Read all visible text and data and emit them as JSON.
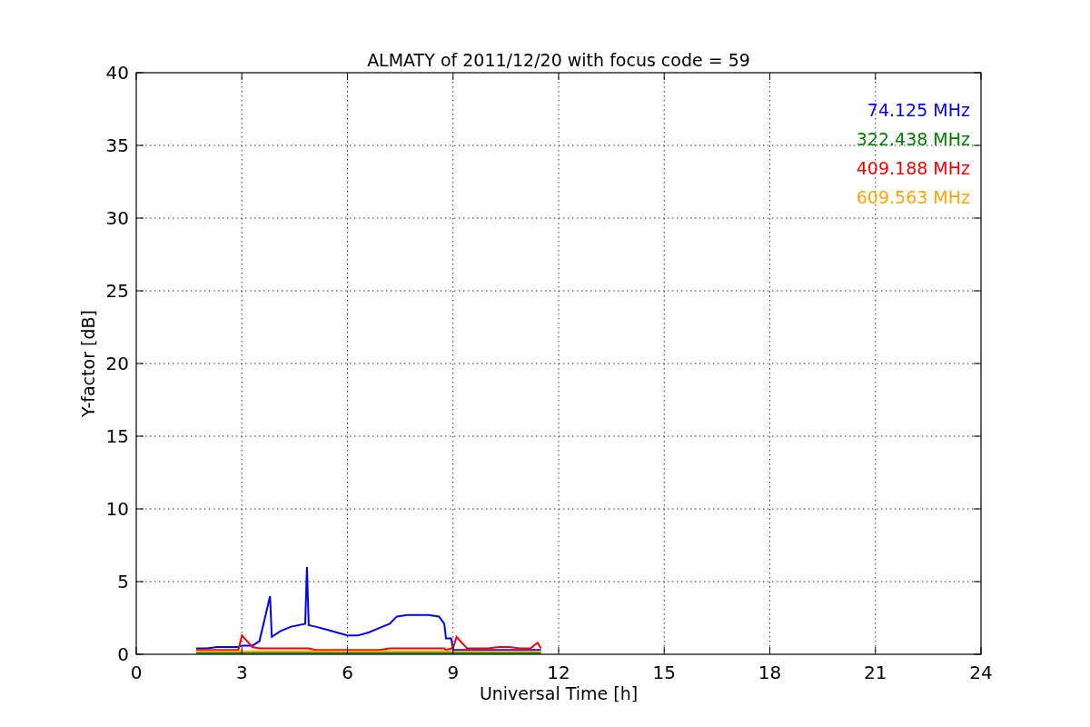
{
  "chart_data": {
    "type": "line",
    "title": "ALMATY of 2011/12/20 with focus code = 59",
    "xlabel": "Universal Time [h]",
    "ylabel": "Y-factor [dB]",
    "x": [
      1.7,
      2.0,
      2.3,
      2.6,
      2.9,
      3.0,
      3.3,
      3.5,
      3.8,
      3.85,
      4.1,
      4.4,
      4.8,
      4.85,
      4.9,
      5.1,
      5.4,
      5.7,
      6.0,
      6.3,
      6.6,
      6.9,
      7.2,
      7.4,
      7.7,
      8.0,
      8.3,
      8.6,
      8.75,
      8.8,
      8.95,
      9.0,
      9.1,
      9.4,
      9.7,
      10.0,
      10.3,
      10.6,
      10.9,
      11.2,
      11.4,
      11.5
    ],
    "series": [
      {
        "name": "74.125 MHz",
        "color": "#0000ff",
        "values": [
          0.4,
          0.4,
          0.5,
          0.5,
          0.5,
          0.6,
          0.6,
          0.9,
          4.0,
          1.2,
          1.6,
          1.9,
          2.1,
          6.0,
          2.0,
          1.9,
          1.7,
          1.5,
          1.3,
          1.3,
          1.5,
          1.8,
          2.1,
          2.6,
          2.7,
          2.7,
          2.7,
          2.6,
          2.1,
          1.1,
          1.1,
          0.3,
          0.3,
          0.3,
          0.3,
          0.3,
          0.3,
          0.3,
          0.3,
          0.3,
          0.3,
          0.3
        ]
      },
      {
        "name": "322.438 MHz",
        "color": "#008000",
        "values": [
          0.1,
          0.1,
          0.1,
          0.1,
          0.1,
          0.1,
          0.1,
          0.1,
          0.1,
          0.1,
          0.1,
          0.1,
          0.1,
          0.1,
          0.1,
          0.1,
          0.1,
          0.1,
          0.1,
          0.1,
          0.1,
          0.1,
          0.1,
          0.1,
          0.1,
          0.1,
          0.1,
          0.1,
          0.1,
          0.1,
          0.1,
          0.1,
          0.1,
          0.1,
          0.1,
          0.1,
          0.1,
          0.1,
          0.1,
          0.1,
          0.1,
          0.1
        ]
      },
      {
        "name": "409.188 MHz",
        "color": "#ff0000",
        "values": [
          0.3,
          0.3,
          0.3,
          0.3,
          0.3,
          1.3,
          0.5,
          0.4,
          0.4,
          0.4,
          0.4,
          0.4,
          0.4,
          0.4,
          0.4,
          0.3,
          0.3,
          0.3,
          0.3,
          0.3,
          0.3,
          0.3,
          0.4,
          0.4,
          0.4,
          0.4,
          0.4,
          0.4,
          0.4,
          0.3,
          0.4,
          0.4,
          1.2,
          0.4,
          0.4,
          0.4,
          0.5,
          0.5,
          0.4,
          0.4,
          0.8,
          0.4
        ]
      },
      {
        "name": "609.563 MHz",
        "color": "#ffa500",
        "values": [
          0.2,
          0.2,
          0.2,
          0.2,
          0.2,
          0.2,
          0.2,
          0.2,
          0.2,
          0.2,
          0.2,
          0.2,
          0.2,
          0.2,
          0.2,
          0.2,
          0.2,
          0.2,
          0.2,
          0.2,
          0.2,
          0.2,
          0.2,
          0.2,
          0.2,
          0.2,
          0.2,
          0.2,
          0.2,
          0.2,
          0.2,
          0.2,
          0.2,
          0.2,
          0.2,
          0.2,
          0.2,
          0.2,
          0.2,
          0.2,
          0.2,
          0.2
        ]
      }
    ],
    "grid": true,
    "xlim": [
      0,
      24
    ],
    "ylim": [
      0,
      40
    ],
    "xticks": [
      0,
      3,
      6,
      9,
      12,
      15,
      18,
      21,
      24
    ],
    "yticks": [
      0,
      5,
      10,
      15,
      20,
      25,
      30,
      35,
      40
    ]
  }
}
